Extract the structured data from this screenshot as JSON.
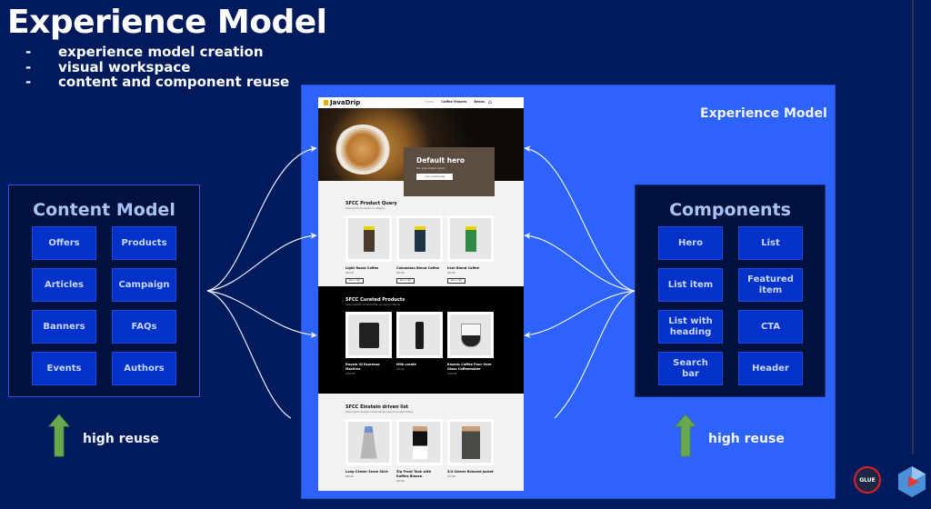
{
  "slide": {
    "title": "Experience Model",
    "bullets": [
      {
        "dash": "-",
        "text": "experience model creation"
      },
      {
        "dash": "-",
        "text": "visual workspace"
      },
      {
        "dash": "-",
        "text": "content and component reuse"
      }
    ],
    "experience_panel_label": "Experience Model"
  },
  "content_model": {
    "title": "Content Model",
    "tiles": [
      "Offers",
      "Products",
      "Articles",
      "Campaign",
      "Banners",
      "FAQs",
      "Events",
      "Authors"
    ],
    "reuse_label": "high reuse"
  },
  "components": {
    "title": "Components",
    "tiles": [
      "Hero",
      "List",
      "List item",
      "Featured item",
      "List with heading",
      "CTA",
      "Search bar",
      "Header"
    ],
    "reuse_label": "high reuse"
  },
  "site": {
    "logo": "JavaDrip",
    "nav": [
      "Home",
      "Coffee Makers",
      "Beans"
    ],
    "cart_icon": "cart-icon",
    "hero": {
      "title": "Default hero",
      "subtitle": "Non personalized version",
      "cta": "CLICK FOR MORE FREE"
    },
    "product_query": {
      "title": "SFCC Product Query",
      "subtitle": "Select products based on category",
      "cards": [
        {
          "name": "Light Roast Coffee",
          "price": "$15.00",
          "button": "ADD TO CART",
          "color": "#4a3b2c"
        },
        {
          "name": "Columbian Blend Coffee",
          "price": "$15.00",
          "button": "ADD TO CART",
          "color": "#1e3447"
        },
        {
          "name": "Irish Blend Coffee",
          "price": "$15.00",
          "button": "ADD TO CART",
          "color": "#2f8a45"
        }
      ]
    },
    "curated": {
      "title": "SFCC Curated Products",
      "subtitle": "Select specific products that you want in the list",
      "cards": [
        {
          "name": "Royale IQ Espresso Machine",
          "price": "$399.99"
        },
        {
          "name": "Milk carafe",
          "price": "$15.00"
        },
        {
          "name": "Kosmic Coffee Pour Over Glass Coffeemaker",
          "price": "$199.99"
        }
      ]
    },
    "einstein": {
      "title": "SFCC Einstein driven list",
      "subtitle": "Select which Einstein model will be used for product listing",
      "cards": [
        {
          "name": "Long Center Seam Skirt",
          "price": "$65.99"
        },
        {
          "name": "Zip Front Tank with Ruffles Blouse.",
          "price": "$39.99"
        },
        {
          "name": "3/4 Sleeve Relaxed Jacket",
          "price": "$79.99"
        }
      ]
    }
  },
  "logos": {
    "glue_badge": "GLUE",
    "brand_icon": "hexagon-play-logo-icon"
  },
  "colors": {
    "background": "#001a5c",
    "experience_panel": "#2d62fb",
    "model_box": "#00113d",
    "tile": "#0432c9",
    "arrow_up": "#6aa84f"
  }
}
